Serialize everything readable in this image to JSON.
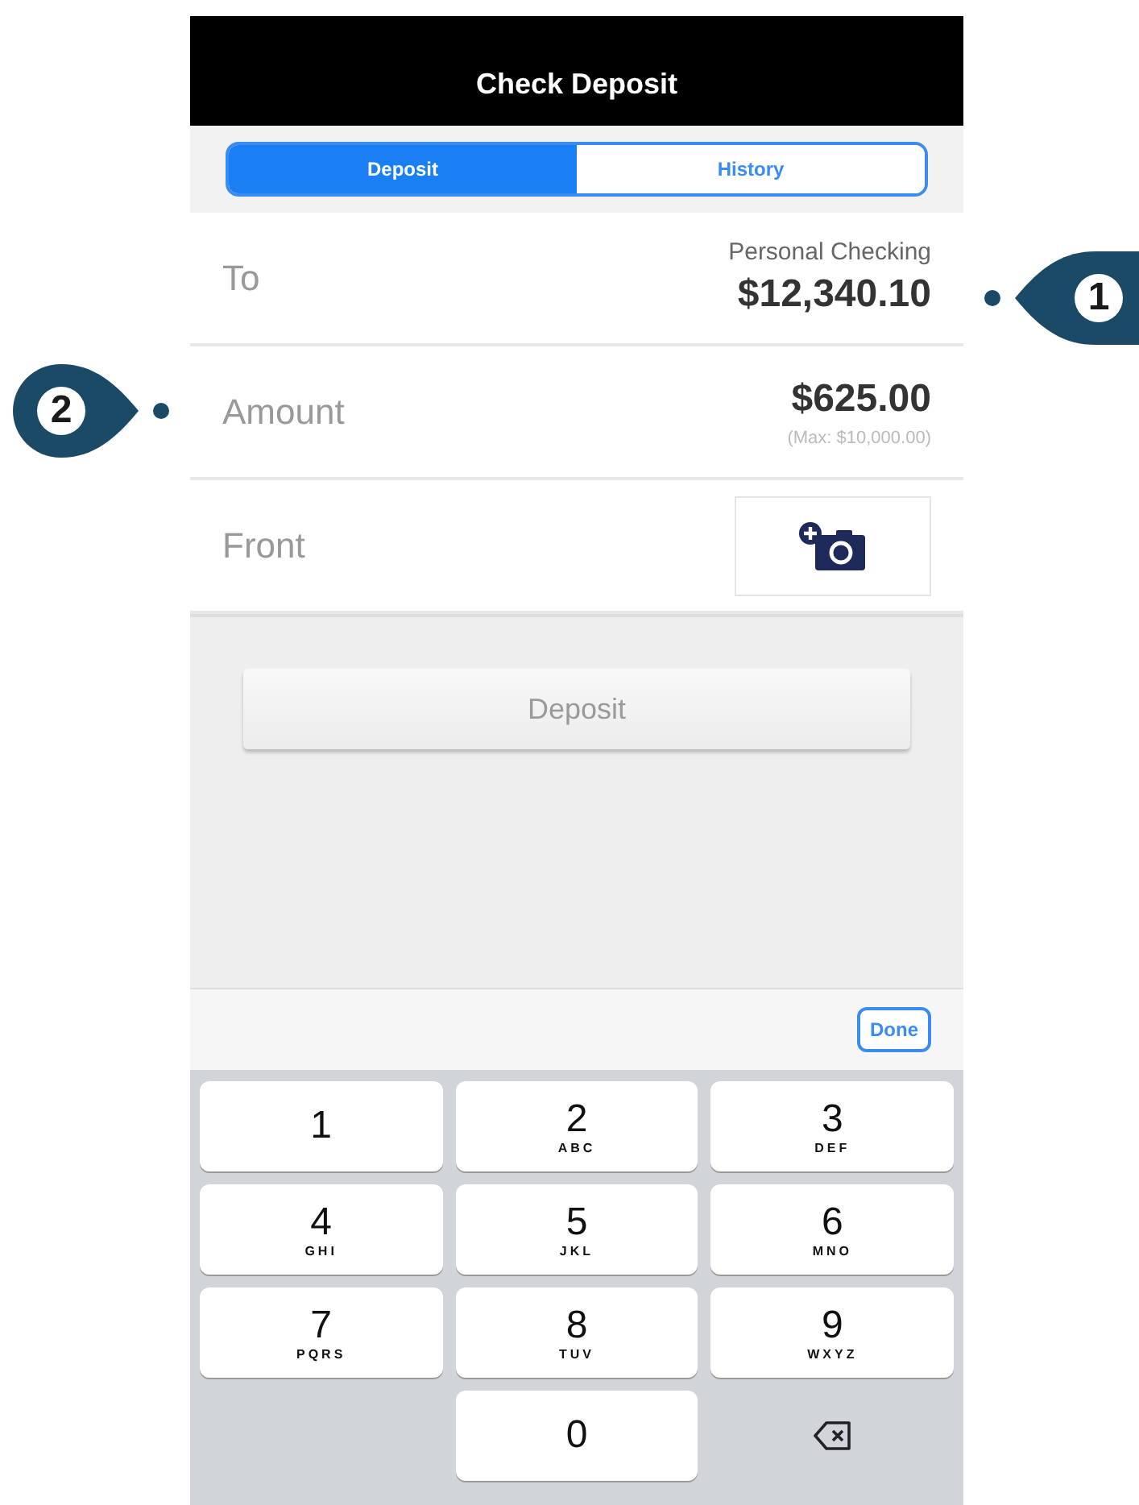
{
  "nav": {
    "title": "Check Deposit"
  },
  "tabs": [
    {
      "label": "Deposit",
      "selected": true
    },
    {
      "label": "History",
      "selected": false
    }
  ],
  "rows": [
    {
      "kind": "account",
      "label": "To",
      "caption": "Personal Checking",
      "value": "$12,340.10"
    },
    {
      "kind": "amount",
      "label": "Amount",
      "value": "$625.00",
      "caption": "(Max: $10,000.00)"
    },
    {
      "kind": "photo",
      "label": "Front"
    }
  ],
  "deposit_button": {
    "label": "Deposit",
    "disabled": true
  },
  "toolbar": {
    "done": "Done"
  },
  "keys": [
    {
      "kind": "digit",
      "digit": "1"
    },
    {
      "kind": "digit",
      "digit": "2",
      "letters": "ABC"
    },
    {
      "kind": "digit",
      "digit": "3",
      "letters": "DEF"
    },
    {
      "kind": "digit",
      "digit": "4",
      "letters": "GHI"
    },
    {
      "kind": "digit",
      "digit": "5",
      "letters": "JKL"
    },
    {
      "kind": "digit",
      "digit": "6",
      "letters": "MNO"
    },
    {
      "kind": "digit",
      "digit": "7",
      "letters": "PQRS"
    },
    {
      "kind": "digit",
      "digit": "8",
      "letters": "TUV"
    },
    {
      "kind": "digit",
      "digit": "9",
      "letters": "WXYZ"
    },
    {
      "kind": "digit",
      "digit": "0"
    },
    {
      "kind": "delete"
    }
  ],
  "callouts": [
    {
      "number": "1",
      "kind": "right"
    },
    {
      "number": "2",
      "kind": "left"
    }
  ]
}
